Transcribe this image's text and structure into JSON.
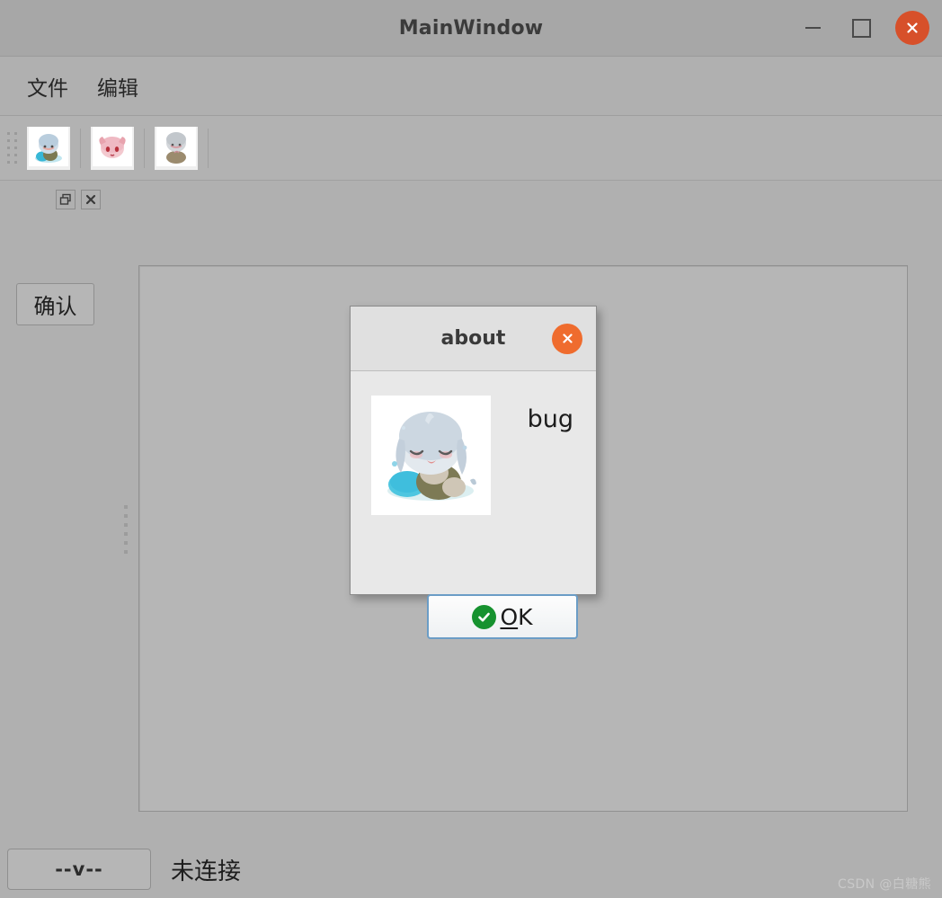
{
  "window": {
    "title": "MainWindow",
    "buttons": {
      "minimize": "minimize",
      "maximize": "maximize",
      "close": "close"
    }
  },
  "menubar": {
    "items": [
      {
        "label": "文件"
      },
      {
        "label": "编辑"
      }
    ]
  },
  "toolbar": {
    "items": [
      {
        "name": "tool-button-1",
        "icon": "chibi-blue-avatar-icon"
      },
      {
        "name": "tool-button-2",
        "icon": "chibi-pink-avatar-icon"
      },
      {
        "name": "tool-button-3",
        "icon": "chibi-grey-avatar-icon"
      }
    ]
  },
  "dock": {
    "float_button": "float",
    "close_button": "close"
  },
  "left_panel": {
    "confirm_label": "确认"
  },
  "statusbar": {
    "button_label": "--v--",
    "status_text": "未连接"
  },
  "watermark": "CSDN @白糖熊",
  "dialog": {
    "title": "about",
    "close_button": "close",
    "image_alt": "chibi-character-image",
    "message": "bug",
    "ok_button": {
      "prefix": "O",
      "suffix": "K"
    }
  },
  "colors": {
    "window_background": "#b0b0b0",
    "titlebar": "#a7a7a7",
    "close_accent": "#d7502a",
    "dialog_close_accent": "#ef6c2e",
    "dialog_background": "#e8e8e8",
    "ok_border": "#6b9dc6",
    "ok_check_green": "#16922f",
    "content_frame": "#b6b6b6"
  }
}
